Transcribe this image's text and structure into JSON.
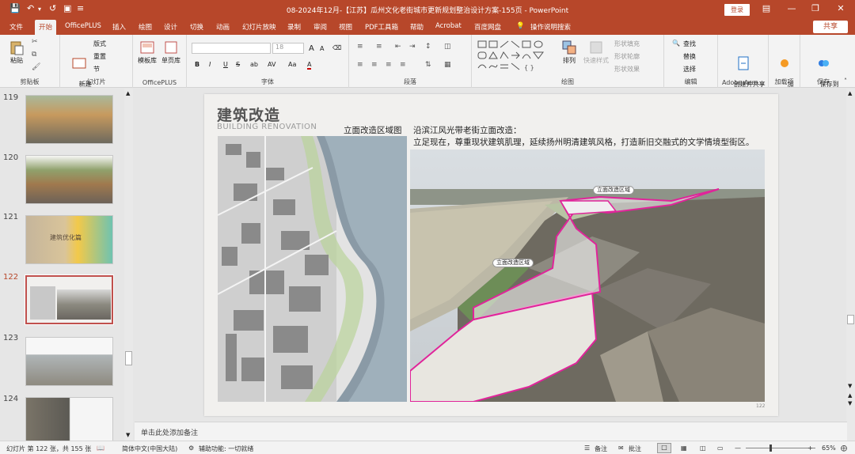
{
  "window": {
    "title": "08-2024年12月-【江苏】瓜州文化老街城市更新规划整治设计方案-155页 - PowerPoint",
    "login": "登录",
    "share": "共享"
  },
  "tabs": [
    "文件",
    "开始",
    "OfficePLUS",
    "插入",
    "绘图",
    "设计",
    "切换",
    "动画",
    "幻灯片放映",
    "录制",
    "审阅",
    "视图",
    "PDF工具箱",
    "帮助",
    "Acrobat",
    "百度网盘",
    "操作说明搜索"
  ],
  "ribbon": {
    "clipboard": {
      "label": "剪贴板",
      "paste": "粘贴"
    },
    "slides": {
      "label": "幻灯片",
      "new_slide": "新建\n幻灯片",
      "layout": "版式",
      "reset": "重置",
      "section": "节"
    },
    "officeplus": {
      "label": "OfficePLUS",
      "template": "模板库",
      "single": "单页库"
    },
    "font": {
      "label": "字体",
      "font_name": "",
      "font_size": "18",
      "bold": "B",
      "italic": "I",
      "underline": "U",
      "strike": "S",
      "shadow": "ab",
      "spacing": "AV",
      "case": "Aa",
      "color": "A",
      "grow": "A",
      "shrink": "A"
    },
    "paragraph": {
      "label": "段落"
    },
    "drawing": {
      "label": "绘图",
      "arrange": "排列",
      "quick_styles": "快速样式",
      "fill": "形状填充",
      "outline": "形状轮廓",
      "effect": "形状效果"
    },
    "editing": {
      "label": "编辑",
      "find": "查找",
      "replace": "替换",
      "select": "选择"
    },
    "adobe": {
      "label": "Adobe Acro...",
      "create": "创建并共享\nAdobe PDF"
    },
    "addins": {
      "label": "加载项",
      "addin": "加\n载项"
    },
    "save": {
      "label": "保存",
      "save_baidu": "保存到\n百度网盘"
    }
  },
  "thumbnails": [
    {
      "num": "119",
      "selected": false
    },
    {
      "num": "120",
      "selected": false
    },
    {
      "num": "121",
      "selected": false,
      "text": "建筑优化篇"
    },
    {
      "num": "122",
      "selected": true
    },
    {
      "num": "123",
      "selected": false
    },
    {
      "num": "124",
      "selected": false
    }
  ],
  "slide": {
    "title": "建筑改造",
    "subtitle": "BUILDING RENOVATION",
    "map_caption": "立面改造区域图",
    "heading": "沿滨江风光带老街立面改造：",
    "body": "立足现在，尊重现状建筑肌理，延续扬州明清建筑风格，打造新旧交融式的文学情境型街区。",
    "label_1": "立面改造区域",
    "label_2": "立面改造区域",
    "page_no": "122"
  },
  "notes": "单击此处添加备注",
  "status": {
    "slide_info": "幻灯片 第 122 张，共 155 张",
    "language": "简体中文(中国大陆)",
    "accessibility": "辅助功能: 一切就绪",
    "notes_btn": "备注",
    "comments_btn": "批注",
    "zoom": "65%"
  }
}
